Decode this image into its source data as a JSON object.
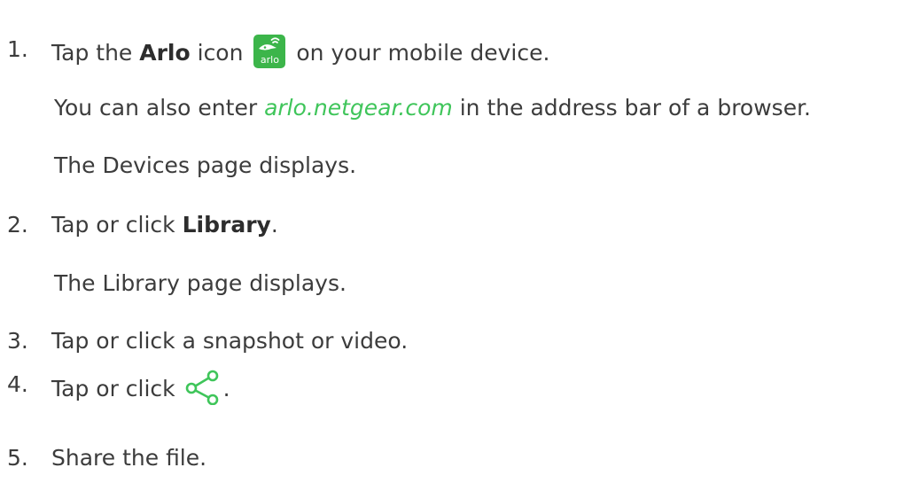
{
  "steps": [
    {
      "number": "1.",
      "parts": {
        "before": "Tap the ",
        "bold": "Arlo",
        "after_bold": " icon ",
        "after_icon": " on your mobile device."
      },
      "icon": "arlo-app-icon",
      "icon_label": "arlo",
      "notes": [
        {
          "before": "You can also enter ",
          "link": "arlo.netgear.com",
          "after": " in the address bar of a browser."
        },
        {
          "text": "The Devices page displays."
        }
      ]
    },
    {
      "number": "2.",
      "parts": {
        "before": "Tap or click ",
        "bold": "Library",
        "after": "."
      },
      "notes": [
        {
          "text": "The Library page displays."
        }
      ]
    },
    {
      "number": "3.",
      "text": "Tap or click a snapshot or video."
    },
    {
      "number": "4.",
      "parts": {
        "before": "Tap or click ",
        "after": "."
      },
      "icon": "share-icon"
    },
    {
      "number": "5.",
      "text": "Share the file."
    }
  ],
  "colors": {
    "text": "#3c3c3c",
    "link": "#3fc55a",
    "icon_green": "#3cb54a"
  }
}
